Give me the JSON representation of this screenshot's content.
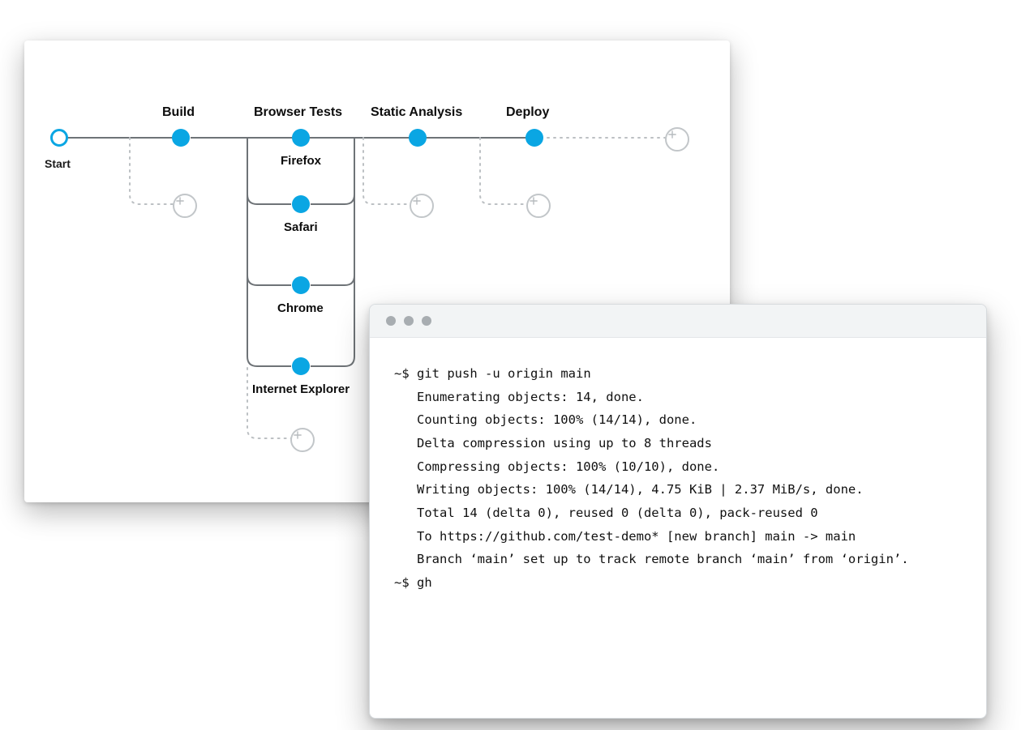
{
  "pipeline": {
    "start_label": "Start",
    "stages": {
      "build": "Build",
      "browser_tests": "Browser Tests",
      "static_analysis": "Static Analysis",
      "deploy": "Deploy"
    },
    "browsers": {
      "firefox": "Firefox",
      "safari": "Safari",
      "chrome": "Chrome",
      "ie": "Internet Explorer"
    },
    "colors": {
      "node": "#0aa6e3",
      "connector": "#6e7377",
      "dotted": "#bcc0c3",
      "plus": "#b7bbbe"
    }
  },
  "terminal": {
    "prompt": "~$",
    "cmd1": "git push -u origin main",
    "out1": "Enumerating objects: 14, done.",
    "out2": "Counting objects: 100% (14/14), done.",
    "out3": "Delta compression using up to 8 threads",
    "out4": "Compressing objects: 100% (10/10), done.",
    "out5": "Writing objects: 100% (14/14), 4.75 KiB | 2.37 MiB/s, done.",
    "out6": "Total 14 (delta 0), reused 0 (delta 0), pack-reused 0",
    "out7": "To https://github.com/test-demo* [new branch] main -> main",
    "out8": "Branch ‘main’ set up to track remote branch ‘main’ from ‘origin’.",
    "cmd2": "gh"
  }
}
